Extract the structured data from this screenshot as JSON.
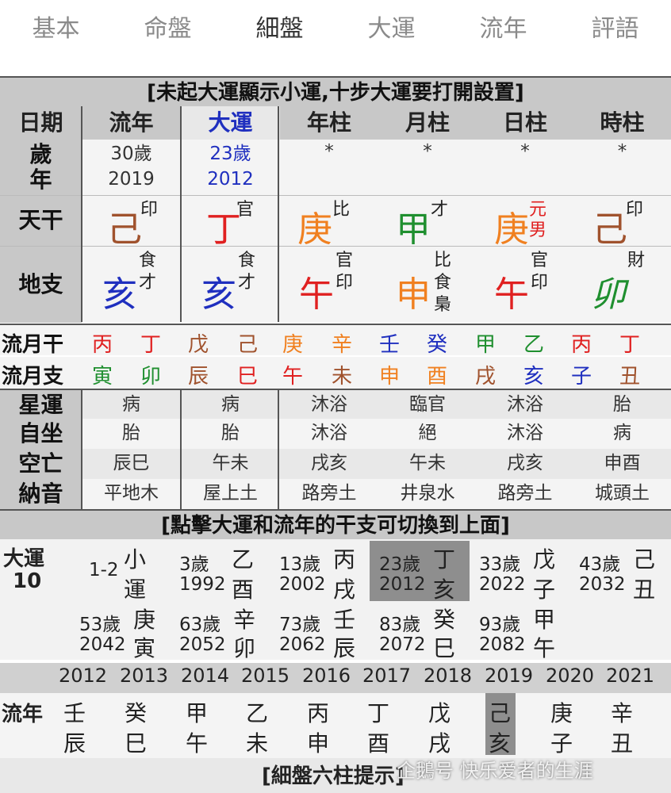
{
  "tabs": [
    "基本",
    "命盤",
    "細盤",
    "大運",
    "流年",
    "評語"
  ],
  "active_tab": 2,
  "banner_top": "[未起大運顯示小運,十步大運要打開設置]",
  "header": [
    "日期",
    "流年",
    "大運",
    "年柱",
    "月柱",
    "日柱",
    "時柱"
  ],
  "age_label": [
    "歲",
    "年"
  ],
  "ages": {
    "liunian_age": "30歲",
    "liunian_year": "2019",
    "dayun_age": "23歲",
    "dayun_year": "2012",
    "star": "*"
  },
  "stem_label": "天干",
  "stems": [
    {
      "ch": "己",
      "god": "印",
      "color": "#a0522d"
    },
    {
      "ch": "丁",
      "god": "官",
      "color": "#e02020"
    },
    {
      "ch": "庚",
      "god": "比",
      "color": "#f08020"
    },
    {
      "ch": "甲",
      "god": "才",
      "color": "#1f8f2f"
    },
    {
      "ch": "庚",
      "god": "元",
      "god2": "男",
      "color": "#f08020"
    },
    {
      "ch": "己",
      "god": "印",
      "color": "#a0522d"
    }
  ],
  "branch_label": "地支",
  "branches": [
    {
      "ch": "亥",
      "gods": [
        "食",
        "才"
      ],
      "color": "#1f2fbf"
    },
    {
      "ch": "亥",
      "gods": [
        "食",
        "才"
      ],
      "color": "#1f2fbf"
    },
    {
      "ch": "午",
      "gods": [
        "官",
        "印"
      ],
      "color": "#e02020"
    },
    {
      "ch": "申",
      "gods": [
        "比",
        "食",
        "梟"
      ],
      "color": "#f08020"
    },
    {
      "ch": "午",
      "gods": [
        "官",
        "印"
      ],
      "color": "#e02020"
    },
    {
      "ch": "卯",
      "gods": [
        "財"
      ],
      "color": "#1f8f2f"
    }
  ],
  "month_stem_label": "流月干",
  "month_stems": [
    {
      "ch": "丙",
      "color": "#e02020"
    },
    {
      "ch": "丁",
      "color": "#e02020"
    },
    {
      "ch": "戊",
      "color": "#a0522d"
    },
    {
      "ch": "己",
      "color": "#a0522d"
    },
    {
      "ch": "庚",
      "color": "#f08020"
    },
    {
      "ch": "辛",
      "color": "#f08020"
    },
    {
      "ch": "壬",
      "color": "#1f2fbf"
    },
    {
      "ch": "癸",
      "color": "#1f2fbf"
    },
    {
      "ch": "甲",
      "color": "#1f8f2f"
    },
    {
      "ch": "乙",
      "color": "#1f8f2f"
    },
    {
      "ch": "丙",
      "color": "#e02020"
    },
    {
      "ch": "丁",
      "color": "#e02020"
    }
  ],
  "month_branch_label": "流月支",
  "month_branches": [
    {
      "ch": "寅",
      "color": "#1f8f2f"
    },
    {
      "ch": "卯",
      "color": "#1f8f2f"
    },
    {
      "ch": "辰",
      "color": "#a0522d"
    },
    {
      "ch": "巳",
      "color": "#e02020"
    },
    {
      "ch": "午",
      "color": "#e02020"
    },
    {
      "ch": "未",
      "color": "#a0522d"
    },
    {
      "ch": "申",
      "color": "#f08020"
    },
    {
      "ch": "酉",
      "color": "#f08020"
    },
    {
      "ch": "戌",
      "color": "#a0522d"
    },
    {
      "ch": "亥",
      "color": "#1f2fbf"
    },
    {
      "ch": "子",
      "color": "#1f2fbf"
    },
    {
      "ch": "丑",
      "color": "#a0522d"
    }
  ],
  "star_label": "星運",
  "star": [
    "病",
    "病",
    "沐浴",
    "臨官",
    "沐浴",
    "胎"
  ],
  "self_label": "自坐",
  "self": [
    "胎",
    "胎",
    "沐浴",
    "絕",
    "沐浴",
    "病"
  ],
  "void_label": "空亡",
  "void": [
    "辰巳",
    "午未",
    "戌亥",
    "午未",
    "戌亥",
    "申酉"
  ],
  "nayin_label": "納音",
  "nayin": [
    "平地木",
    "屋上土",
    "路旁土",
    "井泉水",
    "路旁土",
    "城頭土"
  ],
  "banner_mid": "[點擊大運和流年的干支可切換到上面]",
  "dayun_label": "大運",
  "dayun_start": "10",
  "dayun": [
    {
      "age": "1-2",
      "year": "",
      "g": "小",
      "z": "運"
    },
    {
      "age": "3歲",
      "year": "1992",
      "g": "乙",
      "z": "酉"
    },
    {
      "age": "13歲",
      "year": "2002",
      "g": "丙",
      "z": "戌"
    },
    {
      "age": "23歲",
      "year": "2012",
      "g": "丁",
      "z": "亥"
    },
    {
      "age": "33歲",
      "year": "2022",
      "g": "戊",
      "z": "子"
    },
    {
      "age": "43歲",
      "year": "2032",
      "g": "己",
      "z": "丑"
    },
    {
      "age": "53歲",
      "year": "2042",
      "g": "庚",
      "z": "寅"
    },
    {
      "age": "63歲",
      "year": "2052",
      "g": "辛",
      "z": "卯"
    },
    {
      "age": "73歲",
      "year": "2062",
      "g": "壬",
      "z": "辰"
    },
    {
      "age": "83歲",
      "year": "2072",
      "g": "癸",
      "z": "巳"
    },
    {
      "age": "93歲",
      "year": "2082",
      "g": "甲",
      "z": "午"
    }
  ],
  "selected_dayun": 3,
  "years": [
    "2012",
    "2013",
    "2014",
    "2015",
    "2016",
    "2017",
    "2018",
    "2019",
    "2020",
    "2021"
  ],
  "liunian_label": "流年",
  "liunian": [
    {
      "g": "壬",
      "z": "辰"
    },
    {
      "g": "癸",
      "z": "巳"
    },
    {
      "g": "甲",
      "z": "午"
    },
    {
      "g": "乙",
      "z": "未"
    },
    {
      "g": "丙",
      "z": "申"
    },
    {
      "g": "丁",
      "z": "酉"
    },
    {
      "g": "戊",
      "z": "戌"
    },
    {
      "g": "己",
      "z": "亥"
    },
    {
      "g": "庚",
      "z": "子"
    },
    {
      "g": "辛",
      "z": "丑"
    }
  ],
  "selected_liunian": 7,
  "banner_bottom": "[細盤六柱提示]",
  "watermark": "企鵝号 快乐爱者的生涯"
}
